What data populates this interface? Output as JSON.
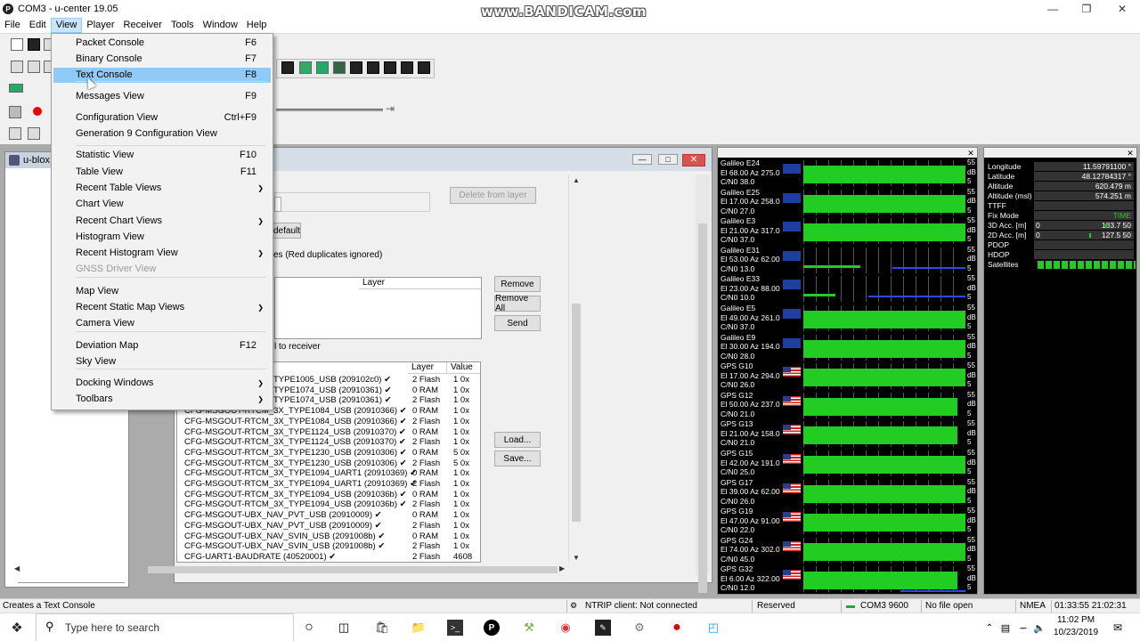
{
  "window": {
    "title": "COM3 - u-center 19.05",
    "watermark": "www.BANDICAM.com"
  },
  "menubar": [
    "File",
    "Edit",
    "View",
    "Player",
    "Receiver",
    "Tools",
    "Window",
    "Help"
  ],
  "view_menu": {
    "items": [
      {
        "label": "Packet Console",
        "shortcut": "F6"
      },
      {
        "label": "Binary Console",
        "shortcut": "F7"
      },
      {
        "label": "Text Console",
        "shortcut": "F8",
        "highlighted": true
      },
      {
        "label": "Messages View",
        "shortcut": "F9"
      },
      {
        "label": "Configuration View",
        "shortcut": "Ctrl+F9"
      },
      {
        "label": "Generation 9 Configuration View",
        "shortcut": ""
      },
      {
        "label": "Statistic View",
        "shortcut": "F10"
      },
      {
        "label": "Table View",
        "shortcut": "F11"
      },
      {
        "label": "Recent Table Views",
        "shortcut": "",
        "submenu": true
      },
      {
        "label": "Chart View",
        "shortcut": ""
      },
      {
        "label": "Recent Chart Views",
        "shortcut": "",
        "submenu": true
      },
      {
        "label": "Histogram View",
        "shortcut": ""
      },
      {
        "label": "Recent Histogram View",
        "shortcut": "",
        "submenu": true
      },
      {
        "label": "GNSS Driver View",
        "shortcut": "",
        "disabled": true
      },
      {
        "label": "Map View",
        "shortcut": ""
      },
      {
        "label": "Recent Static Map Views",
        "shortcut": "",
        "submenu": true
      },
      {
        "label": "Camera View",
        "shortcut": ""
      },
      {
        "label": "Deviation Map",
        "shortcut": "F12"
      },
      {
        "label": "Sky View",
        "shortcut": ""
      },
      {
        "label": "Docking Windows",
        "shortcut": "",
        "submenu": true
      },
      {
        "label": "Toolbars",
        "shortcut": "",
        "submenu": true
      }
    ]
  },
  "left_window": {
    "title": "u-blox"
  },
  "config_window": {
    "delete_from_layer": "Delete from layer",
    "default_btn": "default",
    "duplicates_note": "es (Red duplicates ignored)",
    "layer_header": "Layer",
    "remove": "Remove",
    "remove_all": "Remove All",
    "send": "Send",
    "to_receiver": "l to receiver",
    "load": "Load...",
    "save": "Save...",
    "table_headers": {
      "layer": "Layer",
      "value": "Value"
    },
    "rows": [
      {
        "name": "TYPE1005_USB (209102c0) ✔",
        "layer": "2 Flash",
        "value": "1  0x"
      },
      {
        "name": "TYPE1074_USB (20910361) ✔",
        "layer": "0 RAM",
        "value": "1  0x"
      },
      {
        "name": "TYPE1074_USB (20910361) ✔",
        "layer": "2 Flash",
        "value": "1  0x"
      },
      {
        "name": "CFG-MSGOUT-RTCM_3X_TYPE1084_USB (20910366) ✔",
        "layer": "0 RAM",
        "value": "1  0x"
      },
      {
        "name": "CFG-MSGOUT-RTCM_3X_TYPE1084_USB (20910366) ✔",
        "layer": "2 Flash",
        "value": "1  0x"
      },
      {
        "name": "CFG-MSGOUT-RTCM_3X_TYPE1124_USB (20910370) ✔",
        "layer": "0 RAM",
        "value": "1  0x"
      },
      {
        "name": "CFG-MSGOUT-RTCM_3X_TYPE1124_USB (20910370) ✔",
        "layer": "2 Flash",
        "value": "1  0x"
      },
      {
        "name": "CFG-MSGOUT-RTCM_3X_TYPE1230_USB (20910306) ✔",
        "layer": "0 RAM",
        "value": "5  0x"
      },
      {
        "name": "CFG-MSGOUT-RTCM_3X_TYPE1230_USB (20910306) ✔",
        "layer": "2 Flash",
        "value": "5  0x"
      },
      {
        "name": "CFG-MSGOUT-RTCM_3X_TYPE1094_UART1 (20910369) ✔",
        "layer": "0 RAM",
        "value": "1  0x"
      },
      {
        "name": "CFG-MSGOUT-RTCM_3X_TYPE1094_UART1 (20910369) ✔",
        "layer": "2 Flash",
        "value": "1  0x"
      },
      {
        "name": "CFG-MSGOUT-RTCM_3X_TYPE1094_USB (2091036b) ✔",
        "layer": "0 RAM",
        "value": "1  0x"
      },
      {
        "name": "CFG-MSGOUT-RTCM_3X_TYPE1094_USB (2091036b) ✔",
        "layer": "2 Flash",
        "value": "1  0x"
      },
      {
        "name": "CFG-MSGOUT-UBX_NAV_PVT_USB (20910009) ✔",
        "layer": "0 RAM",
        "value": "1  0x"
      },
      {
        "name": "CFG-MSGOUT-UBX_NAV_PVT_USB (20910009) ✔",
        "layer": "2 Flash",
        "value": "1  0x"
      },
      {
        "name": "CFG-MSGOUT-UBX_NAV_SVIN_USB (2091008b) ✔",
        "layer": "0 RAM",
        "value": "1  0x"
      },
      {
        "name": "CFG-MSGOUT-UBX_NAV_SVIN_USB (2091008b) ✔",
        "layer": "2 Flash",
        "value": "1  0x"
      },
      {
        "name": "CFG-UART1-BAUDRATE (40520001) ✔",
        "layer": "2 Flash",
        "value": "4608"
      }
    ]
  },
  "satellites": [
    {
      "id": "Galileo E24",
      "el": "El 68.00 Az 275.0",
      "cno": "C/N0 38.0",
      "flag": "eu",
      "fill": 1.0,
      "blue": 0
    },
    {
      "id": "Galileo E25",
      "el": "El 17.00 Az 258.0",
      "cno": "C/N0 27.0",
      "flag": "eu",
      "fill": 1.0,
      "blue": 0
    },
    {
      "id": "Galileo E3",
      "el": "El 21.00 Az 317.0",
      "cno": "C/N0 37.0",
      "flag": "eu",
      "fill": 1.0,
      "blue": 0
    },
    {
      "id": "Galileo E31",
      "el": "El 53.00 Az 62.00",
      "cno": "C/N0 13.0",
      "flag": "eu",
      "fill": 0.35,
      "blue": 0.45
    },
    {
      "id": "Galileo E33",
      "el": "El 23.00 Az 88.00",
      "cno": "C/N0 10.0",
      "flag": "eu",
      "fill": 0.2,
      "blue": 0.6
    },
    {
      "id": "Galileo E5",
      "el": "El 49.00 Az 261.0",
      "cno": "C/N0 37.0",
      "flag": "eu",
      "fill": 1.0,
      "blue": 0
    },
    {
      "id": "Galileo E9",
      "el": "El 30.00 Az 194.0",
      "cno": "C/N0 28.0",
      "flag": "eu",
      "fill": 1.0,
      "blue": 0
    },
    {
      "id": "GPS G10",
      "el": "El 17.00 Az 294.0",
      "cno": "C/N0 26.0",
      "flag": "us",
      "fill": 1.0,
      "blue": 0
    },
    {
      "id": "GPS G12",
      "el": "El 50.00 Az 237.0",
      "cno": "C/N0 21.0",
      "flag": "us",
      "fill": 0.95,
      "blue": 0
    },
    {
      "id": "GPS G13",
      "el": "El 21.00 Az 158.0",
      "cno": "C/N0 21.0",
      "flag": "us",
      "fill": 0.95,
      "blue": 0
    },
    {
      "id": "GPS G15",
      "el": "El 42.00 Az 191.0",
      "cno": "C/N0 25.0",
      "flag": "us",
      "fill": 1.0,
      "blue": 0
    },
    {
      "id": "GPS G17",
      "el": "El 39.00 Az 62.00",
      "cno": "C/N0 26.0",
      "flag": "us",
      "fill": 1.0,
      "blue": 0
    },
    {
      "id": "GPS G19",
      "el": "El 47.00 Az 91.00",
      "cno": "C/N0 22.0",
      "flag": "us",
      "fill": 1.0,
      "blue": 0
    },
    {
      "id": "GPS G24",
      "el": "El 74.00 Az 302.0",
      "cno": "C/N0 45.0",
      "flag": "us",
      "fill": 1.0,
      "blue": 0
    },
    {
      "id": "GPS G32",
      "el": "El 6.00 Az 322.00",
      "cno": "C/N0 12.0",
      "flag": "us",
      "fill": 0.95,
      "blue": 0.4
    }
  ],
  "sat_scale": {
    "max": "55",
    "unit": "dB",
    "min": "5"
  },
  "nav_data": [
    {
      "key": "Longitude",
      "value": "11.59791100 °"
    },
    {
      "key": "Latitude",
      "value": "48.12784317 °"
    },
    {
      "key": "Altitude",
      "value": "620.479 m"
    },
    {
      "key": "Altitude (msl)",
      "value": "574.251 m"
    },
    {
      "key": "TTFF",
      "value": ""
    },
    {
      "key": "Fix Mode",
      "value": "TIME"
    },
    {
      "key": "3D Acc. [m]",
      "value": "133.7   50",
      "bar_left": "0"
    },
    {
      "key": "2D Acc. [m]",
      "value": "127.5   50",
      "bar_left": "0"
    },
    {
      "key": "PDOP",
      "value": ""
    },
    {
      "key": "HDOP",
      "value": ""
    },
    {
      "key": "Satellites",
      "value": ""
    }
  ],
  "statusbar": {
    "hint": "Creates a Text Console",
    "ntrip": "NTRIP client: Not connected",
    "reserved": "Reserved",
    "port": "COM3 9600",
    "file": "No file open",
    "protocol": "NMEA",
    "times": "01:33:55  21:02:31"
  },
  "taskbar": {
    "search_placeholder": "Type here to search",
    "time": "11:02 PM",
    "date": "10/23/2019"
  },
  "colors": {
    "signal": "#22cc22",
    "low_signal": "#2f47ff",
    "menu_highlight": "#91c9f7"
  }
}
